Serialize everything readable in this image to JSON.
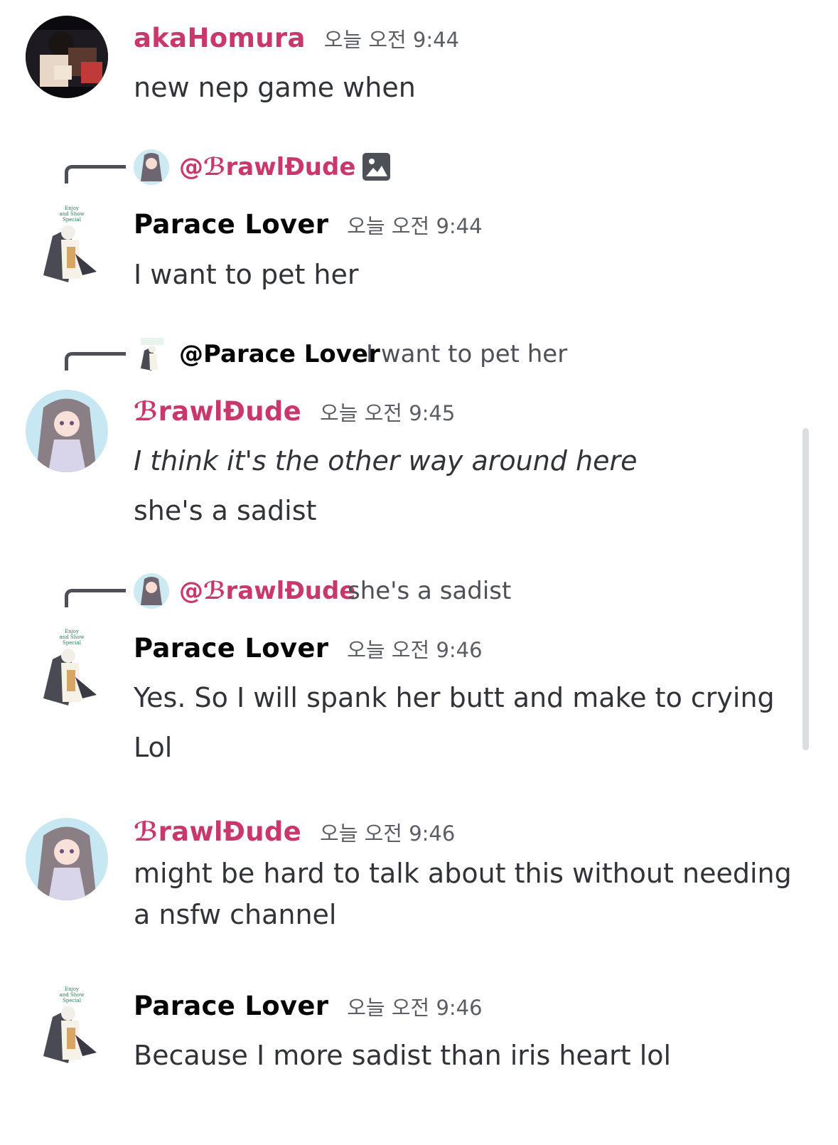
{
  "messages": [
    {
      "author": "akaHomura",
      "timestamp": "오늘 오전 9:44",
      "lines": [
        "new nep game when"
      ]
    },
    {
      "reply": {
        "name": "@ℬrawlĐude",
        "text": ""
      },
      "author": "Parace Lover",
      "timestamp": "오늘 오전 9:44",
      "lines": [
        "I want to pet her"
      ]
    },
    {
      "reply": {
        "name": "@Parace Lover",
        "text": "I want to pet her"
      },
      "author": "ℬrawlĐude",
      "timestamp": "오늘 오전 9:45",
      "lines": [
        "I think it's the other way around here",
        "she's a sadist"
      ]
    },
    {
      "reply": {
        "name": "@ℬrawlĐude",
        "text": "she's a sadist"
      },
      "author": "Parace Lover",
      "timestamp": "오늘 오전 9:46",
      "lines": [
        "Yes. So I will spank her butt and make to crying",
        "Lol"
      ]
    },
    {
      "author": "ℬrawlĐude",
      "timestamp": "오늘 오전 9:46",
      "lines": [
        "might be hard to talk about this without needing",
        "a nsfw channel"
      ]
    },
    {
      "author": "Parace Lover",
      "timestamp": "오늘 오전 9:46",
      "lines": [
        "Because I more sadist than iris heart lol"
      ]
    }
  ],
  "colors": {
    "pink_name": "#c9386b",
    "dark_name": "#060607",
    "timestamp": "#5c5e66",
    "text": "#313338"
  },
  "icons": {
    "reply_attachment": "image-icon"
  },
  "avatar_images": {
    "akaHomura": "dark anime avatar",
    "Parace Lover": "white-haired character sprite",
    "ℬrawlĐude": "light blue anime girl avatar"
  }
}
